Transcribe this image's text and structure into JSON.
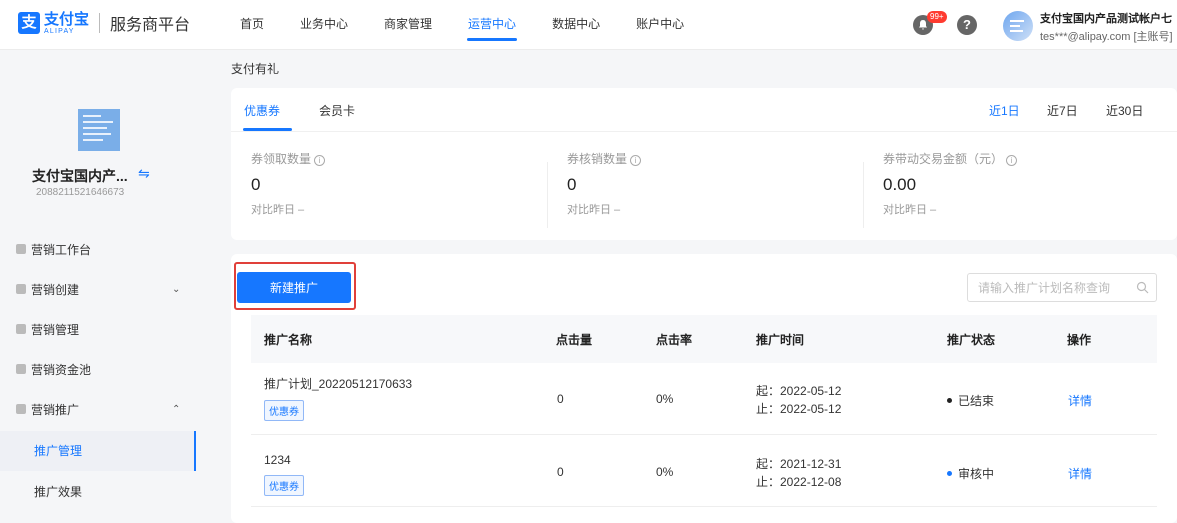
{
  "header": {
    "logo_cn": "支付宝",
    "logo_en": "ALIPAY",
    "platform": "服务商平台",
    "nav": [
      {
        "label": "首页"
      },
      {
        "label": "业务中心"
      },
      {
        "label": "商家管理"
      },
      {
        "label": "运营中心",
        "active": true
      },
      {
        "label": "数据中心"
      },
      {
        "label": "账户中心"
      }
    ],
    "badge": "99+",
    "account_name": "支付宝国内产品测试帐户七",
    "account_email": "tes***@alipay.com [主账号]"
  },
  "sidebar": {
    "merchant_name": "支付宝国内产...",
    "merchant_id": "2088211521646673",
    "items": [
      {
        "label": "营销工作台"
      },
      {
        "label": "营销创建",
        "chevron": "⌄"
      },
      {
        "label": "营销管理"
      },
      {
        "label": "营销资金池"
      },
      {
        "label": "营销推广",
        "chevron": "⌃"
      }
    ],
    "sub_items": [
      {
        "label": "推广管理",
        "active": true
      },
      {
        "label": "推广效果"
      }
    ]
  },
  "breadcrumb": "支付有礼",
  "tabs": [
    {
      "label": "优惠券",
      "active": true
    },
    {
      "label": "会员卡"
    }
  ],
  "ranges": [
    {
      "label": "近1日",
      "active": true
    },
    {
      "label": "近7日"
    },
    {
      "label": "近30日"
    }
  ],
  "stats": [
    {
      "label": "券领取数量",
      "value": "0",
      "compare": "对比昨日 –"
    },
    {
      "label": "券核销数量",
      "value": "0",
      "compare": "对比昨日 –"
    },
    {
      "label": "券带动交易金额（元）",
      "value": "0.00",
      "compare": "对比昨日 –"
    }
  ],
  "actions": {
    "new_button": "新建推广",
    "search_placeholder": "请输入推广计划名称查询"
  },
  "table": {
    "columns": [
      "推广名称",
      "点击量",
      "点击率",
      "推广时间",
      "推广状态",
      "操作"
    ],
    "rows": [
      {
        "name": "推广计划_20220512170633",
        "tag": "优惠券",
        "clicks": "0",
        "rate": "0%",
        "start": "起：2022-05-12",
        "end": "止：2022-05-12",
        "status": "已结束",
        "status_color": "#222222",
        "action": "详情"
      },
      {
        "name": "1234",
        "tag": "优惠券",
        "clicks": "0",
        "rate": "0%",
        "start": "起：2021-12-31",
        "end": "止：2022-12-08",
        "status": "审核中",
        "status_color": "#1677ff",
        "action": "详情"
      }
    ]
  },
  "colors": {
    "accent": "#1677ff",
    "highlight": "#e0403a"
  }
}
